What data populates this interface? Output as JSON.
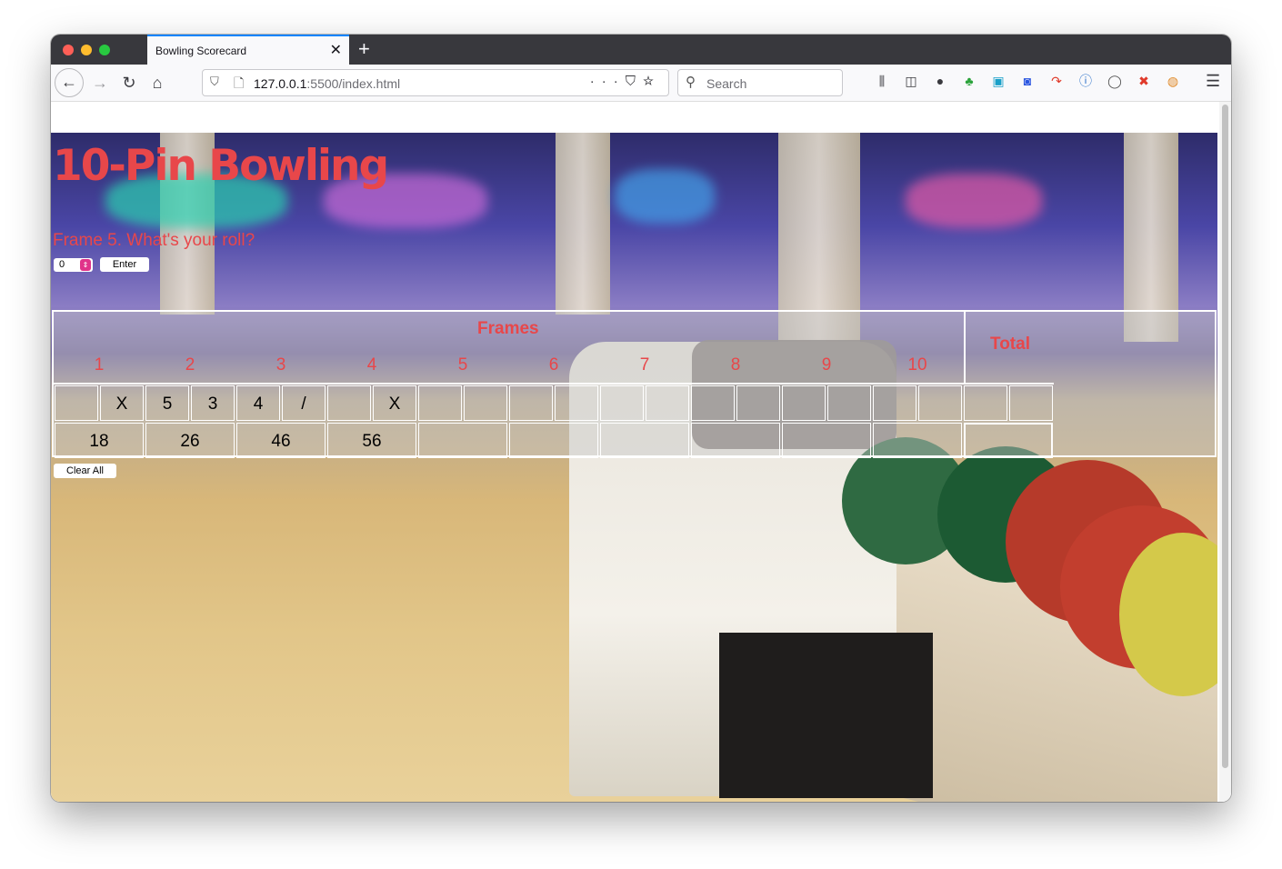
{
  "browser": {
    "tab_title": "Bowling Scorecard",
    "url_host": "127.0.0.1",
    "url_rest": ":5500/index.html",
    "search_placeholder": "Search"
  },
  "page": {
    "title": "10-Pin Bowling",
    "prompt": "Frame 5. What's your roll?",
    "roll_value": "0",
    "enter_label": "Enter",
    "clear_label": "Clear All"
  },
  "scorecard": {
    "frames_label": "Frames",
    "total_label": "Total",
    "frame_numbers": [
      "1",
      "2",
      "3",
      "4",
      "5",
      "6",
      "7",
      "8",
      "9",
      "10"
    ],
    "rolls": [
      "",
      "X",
      "5",
      "3",
      "4",
      "/",
      "",
      "X",
      "",
      "",
      "",
      "",
      "",
      "",
      "",
      "",
      "",
      "",
      "",
      "",
      ""
    ],
    "scores": [
      "18",
      "26",
      "46",
      "56",
      "",
      "",
      "",
      "",
      "",
      ""
    ],
    "total": ""
  }
}
